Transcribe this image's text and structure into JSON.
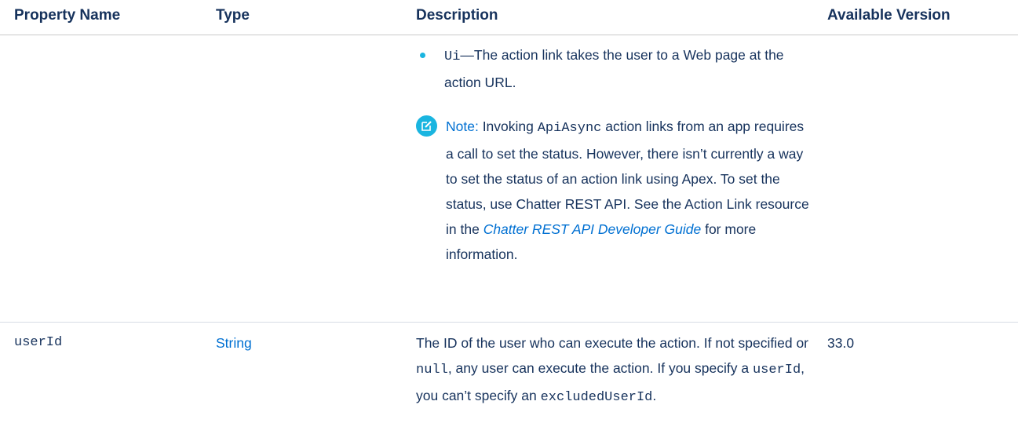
{
  "table": {
    "headers": {
      "property_name": "Property Name",
      "type": "Type",
      "description": "Description",
      "available_version": "Available Version"
    },
    "row1": {
      "bullet_code": "Ui",
      "bullet_text": "—The action link takes the user to a Web page at the action URL.",
      "note": {
        "label": "Note:",
        "text_1": " Invoking ",
        "code_1": "ApiAsync",
        "text_2": " action links from an app requires a call to set the status. However, there isn’t currently a way to set the status of an action link using Apex. To set the status, use Chatter REST API. See the Action Link resource in the ",
        "link_text": "Chatter REST API Developer Guide",
        "text_3": " for more information."
      }
    },
    "row2": {
      "property_name": "userId",
      "type": "String",
      "desc_text_1": "The ID of the user who can execute the action. If not specified or ",
      "desc_code_1": "null",
      "desc_text_2": ", any user can execute the action. If you specify a ",
      "desc_code_2": "userId",
      "desc_text_3": ", you can’t specify an ",
      "desc_code_3": "excludedUserId",
      "desc_text_4": ".",
      "available_version": "33.0"
    }
  },
  "colors": {
    "text": "#16325c",
    "link": "#0070d2",
    "accent": "#1ab5e0",
    "divider": "#d8dde6"
  },
  "icons": {
    "note": "note-edit-icon",
    "bullet": "bullet-dot-icon"
  }
}
